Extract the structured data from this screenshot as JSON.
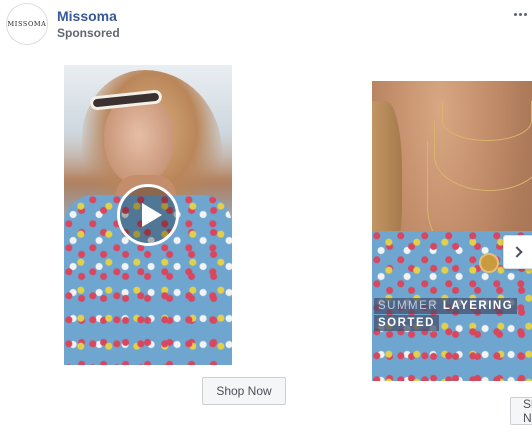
{
  "header": {
    "avatar_text": "MISSOMA",
    "page_name": "Missoma",
    "sponsored_label": "Sponsored",
    "more_icon": "more-horizontal-icon"
  },
  "carousel": {
    "cards": [
      {
        "media_type": "video",
        "play_icon": "play-icon",
        "cta_label": "Shop Now"
      },
      {
        "media_type": "image",
        "overlay_line1_light": "SUMMER ",
        "overlay_line1_bold": "LAYERING",
        "overlay_line2": "SORTED",
        "cta_label": "Shop Now"
      }
    ],
    "next_icon": "chevron-right-icon"
  },
  "colors": {
    "page_name": "#385898",
    "secondary_text": "#606770",
    "button_bg": "#f5f6f7",
    "button_border": "#ccd0d5"
  }
}
